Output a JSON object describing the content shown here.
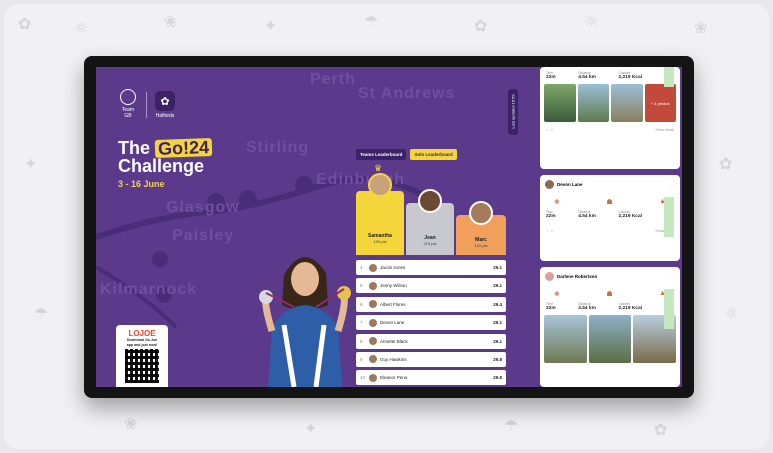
{
  "challenge": {
    "brand_left": "Team GB",
    "brand_right": "Halfords",
    "title_prefix": "The",
    "title_badge": "Go!24",
    "title_suffix": "Challenge",
    "dates": "3 - 16 June",
    "vertical_tab": "Last updated 16:59"
  },
  "map_labels": [
    "Perth",
    "St Andrews",
    "Stirling",
    "Edinburgh",
    "Glasgow",
    "Paisley",
    "Kilmarnock"
  ],
  "qr_card": {
    "brand": "LOJOE",
    "text_line1": "Download Go.Joe",
    "text_line2": "app and join now!"
  },
  "leaderboard": {
    "tabs": [
      "Teams Leaderboard",
      "Solo Leaderboard"
    ],
    "active_tab": "Solo Leaderboard",
    "podium": [
      {
        "place": 1,
        "name": "Samantha",
        "points": "190 pts"
      },
      {
        "place": 2,
        "name": "Jean",
        "points": "215 pts"
      },
      {
        "place": 3,
        "name": "Marc",
        "points": "120 pts"
      }
    ],
    "rows": [
      {
        "rank": "4",
        "name": "Jacob Jones",
        "points": "29.1"
      },
      {
        "rank": "5",
        "name": "Jenny Wilson",
        "points": "29.1"
      },
      {
        "rank": "6",
        "name": "Albert Flores",
        "points": "29.4"
      },
      {
        "rank": "7",
        "name": "Devon Lane",
        "points": "29.1"
      },
      {
        "rank": "8",
        "name": "Annette Black",
        "points": "29.1"
      },
      {
        "rank": "9",
        "name": "Guy Hawkins",
        "points": "29.8"
      },
      {
        "rank": "10",
        "name": "Eleanor Pena",
        "points": "29.8"
      }
    ]
  },
  "feed": {
    "posts": [
      {
        "author": "",
        "stats": [
          {
            "label": "Time",
            "value": "22m"
          },
          {
            "label": "Distance",
            "value": "4.54 km"
          },
          {
            "label": "Calories",
            "value": "2,219 Kcal"
          },
          {
            "label": "Score",
            "value": "97.2"
          }
        ],
        "more_photos": "+ 4 photos",
        "footer": "Show detail"
      },
      {
        "author": "Devon Lane",
        "stats": [
          {
            "label": "Time",
            "value": "22m"
          },
          {
            "label": "Distance",
            "value": "4.54 km"
          },
          {
            "label": "Calories",
            "value": "2,219 Kcal"
          },
          {
            "label": "Score",
            "value": "97.2"
          }
        ],
        "footer": "Show detail"
      },
      {
        "author": "Darlene Robertson",
        "stats": [
          {
            "label": "Time",
            "value": "22m"
          },
          {
            "label": "Distance",
            "value": "4.54 km"
          },
          {
            "label": "Calories",
            "value": "2,219 Kcal"
          },
          {
            "label": "Score",
            "value": "97.2"
          }
        ]
      }
    ]
  },
  "colors": {
    "purple": "#5b3a8c",
    "dark_purple": "#3b2166",
    "yellow": "#f4d63b",
    "silver": "#c8c8cf",
    "bronze": "#f0a05a"
  }
}
